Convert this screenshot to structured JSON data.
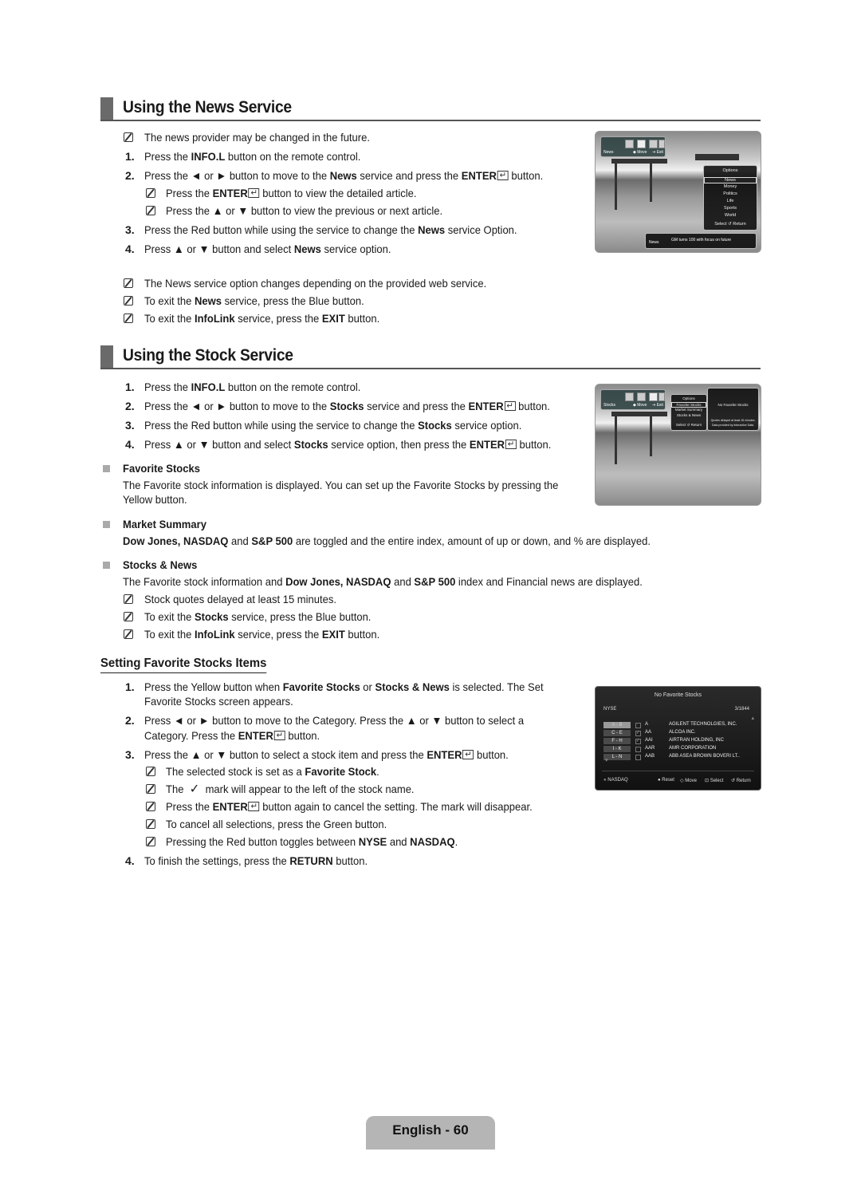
{
  "news_section": {
    "title": "Using the News Service",
    "note_provider": "The news provider may be changed in the future.",
    "steps": [
      {
        "num": "1.",
        "parts": [
          "Press the ",
          "INFO.L",
          " button on the remote control."
        ]
      },
      {
        "num": "2.",
        "parts": [
          "Press the ◄ or ► button to move to the ",
          "News",
          " service and press the ",
          "ENTER",
          " button."
        ]
      },
      {
        "num": "3.",
        "parts": [
          "Press the Red button while using the service to change the ",
          "News",
          " service Option."
        ]
      },
      {
        "num": "4.",
        "parts": [
          "Press ▲ or ▼ button and select ",
          "News",
          " service option."
        ]
      }
    ],
    "step2_notes": [
      {
        "parts": [
          "Press the ",
          "ENTER",
          " button to view the detailed article."
        ]
      },
      {
        "parts": [
          "Press the ▲ or ▼ button to view the previous or next article."
        ]
      }
    ],
    "notes": [
      {
        "parts": [
          "The News service option changes depending on the provided web service."
        ]
      },
      {
        "parts": [
          "To exit the ",
          "News",
          " service, press the Blue button."
        ]
      },
      {
        "parts": [
          "To exit the ",
          "InfoLink",
          " service, press the ",
          "EXIT",
          " button."
        ]
      }
    ],
    "screenshot": {
      "service_label": "News",
      "move_label": "◆ Move",
      "exit_label": "⇥ Exit",
      "options_title": "Options",
      "options": [
        "News",
        "Money",
        "Politics",
        "Life",
        "Sports",
        "World"
      ],
      "selected_option": "News",
      "footer": "Select  ↺ Return",
      "ticker_label": "News",
      "ticker_text": "GM turns 100 with focus on future"
    }
  },
  "stock_section": {
    "title": "Using the Stock Service",
    "steps": [
      {
        "num": "1.",
        "parts": [
          "Press the ",
          "INFO.L",
          " button on the remote control."
        ]
      },
      {
        "num": "2.",
        "parts": [
          "Press the ◄ or ► button to move to the ",
          "Stocks",
          " service and press the ",
          "ENTER",
          " button."
        ]
      },
      {
        "num": "3.",
        "parts": [
          "Press the Red button while using the service to change the ",
          "Stocks",
          " service option."
        ]
      },
      {
        "num": "4.",
        "parts": [
          "Press ▲ or ▼ button and select ",
          "Stocks",
          " service option, then press the ",
          "ENTER",
          " button."
        ]
      }
    ],
    "favorite_stocks": {
      "heading": "Favorite Stocks",
      "line1": "The Favorite stock information is displayed. You can set up the Favorite Stocks by pressing the",
      "line2": "Yellow button."
    },
    "market_summary": {
      "heading": "Market Summary",
      "parts": [
        "Dow Jones, NASDAQ",
        " and ",
        "S&P 500",
        " are toggled and the entire index, amount of up or down, and % are displayed."
      ]
    },
    "stocks_news": {
      "heading": "Stocks & News",
      "parts": [
        "The Favorite stock information and ",
        "Dow Jones, NASDAQ",
        " and ",
        "S&P 500",
        " index and Financial news are displayed."
      ]
    },
    "notes": [
      {
        "parts": [
          "Stock quotes delayed at least 15 minutes."
        ]
      },
      {
        "parts": [
          "To exit the ",
          "Stocks",
          " service, press the Blue button."
        ]
      },
      {
        "parts": [
          "To exit the ",
          "InfoLink",
          " service, press the ",
          "EXIT",
          " button."
        ]
      }
    ],
    "screenshot": {
      "service_label": "Stocks",
      "move_label": "◆ Move",
      "exit_label": "⇥ Exit",
      "options_title": "Options",
      "options": [
        "Favorite Stocks",
        "Market Summary",
        "Stocks & News"
      ],
      "selected_option": "Favorite Stocks",
      "footer": "Select  ↺ Return",
      "panel_title": "No Favorite Stocks",
      "panel_line1": "Quotes delayed at least 15 minutes.",
      "panel_line2": "Data provided by Interactive Data."
    }
  },
  "setting_section": {
    "title": "Setting Favorite Stocks Items",
    "step1": {
      "num": "1.",
      "line1_parts": [
        "Press the Yellow button when ",
        "Favorite Stocks",
        " or ",
        "Stocks & News",
        " is selected. The Set"
      ],
      "line2": "Favorite Stocks screen appears."
    },
    "step2": {
      "num": "2.",
      "line1": "Press ◄ or ► button to move to the Category. Press the ▲ or ▼ button to select a",
      "line2_parts": [
        "Category. Press the ",
        "ENTER",
        " button."
      ]
    },
    "step3": {
      "num": "3.",
      "parts": [
        "Press the ▲ or ▼ button to select a stock item and press the ",
        "ENTER",
        " button."
      ]
    },
    "step3_notes": [
      {
        "parts": [
          "The selected stock is set as a ",
          "Favorite Stock",
          "."
        ]
      },
      {
        "parts": [
          "The ",
          "✓",
          " mark will appear to the left of the stock name."
        ]
      },
      {
        "parts": [
          "Press the ",
          "ENTER",
          " button again to cancel the setting. The mark will disappear."
        ]
      },
      {
        "parts": [
          "To cancel all selections, press the Green button."
        ]
      },
      {
        "parts": [
          "Pressing the Red button toggles between ",
          "NYSE",
          " and ",
          "NASDAQ",
          "."
        ]
      }
    ],
    "step4": {
      "num": "4.",
      "parts": [
        "To finish the settings, press the ",
        "RETURN",
        " button."
      ]
    },
    "screenshot": {
      "title": "No Favorite Stocks",
      "exchange": "NYSE",
      "count": "3/1844",
      "categories": [
        "A - B",
        "C - E",
        "F - H",
        "I - K",
        "L - N"
      ],
      "selected_category": "A - B",
      "rows": [
        {
          "checked": false,
          "symbol": "A",
          "name": "AGILENT TECHNOLGIES, INC."
        },
        {
          "checked": true,
          "symbol": "AA",
          "name": "ALCOA INC."
        },
        {
          "checked": true,
          "symbol": "AAI",
          "name": "AIRTRAN HOLDING, INC"
        },
        {
          "checked": false,
          "symbol": "AAR",
          "name": "AMR CORPORATION"
        },
        {
          "checked": false,
          "symbol": "AAB",
          "name": "ABB ASEA BROWN BOVERI LT.."
        }
      ],
      "footer_toggle": "NASDAQ",
      "footer_reset": "Reset",
      "footer_move": "Move",
      "footer_select": "Select",
      "footer_return": "Return"
    }
  },
  "page_footer": "English - 60"
}
